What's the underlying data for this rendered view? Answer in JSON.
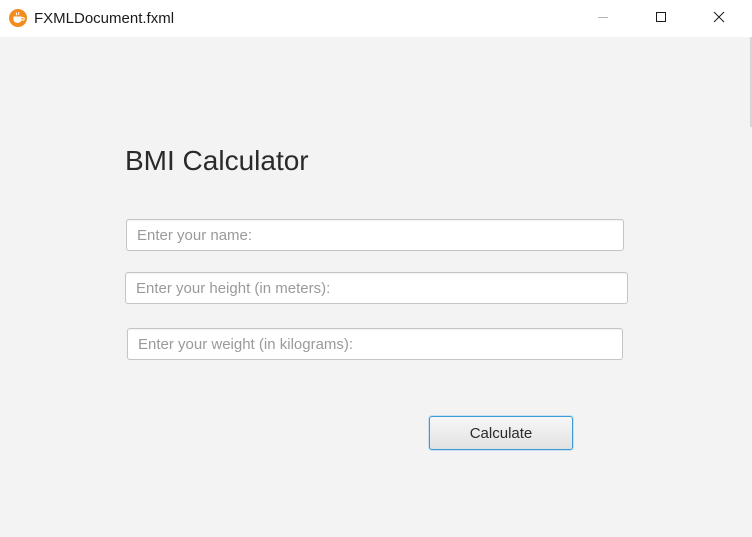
{
  "window": {
    "title": "FXMLDocument.fxml",
    "app_icon": "java-cup-icon",
    "controls": {
      "minimize_icon": "minimize-icon",
      "maximize_icon": "maximize-icon",
      "close_icon": "close-icon"
    }
  },
  "form": {
    "heading": "BMI Calculator",
    "name_field": {
      "value": "",
      "placeholder": "Enter your name:"
    },
    "height_field": {
      "value": "",
      "placeholder": "Enter your height (in meters):"
    },
    "weight_field": {
      "value": "",
      "placeholder": "Enter your weight (in kilograms):"
    },
    "calculate_label": "Calculate"
  },
  "colors": {
    "background": "#f3f3f3",
    "titlebar": "#ffffff",
    "button_focus_border": "#3c9bd6",
    "app_icon": "#f28c1e"
  }
}
